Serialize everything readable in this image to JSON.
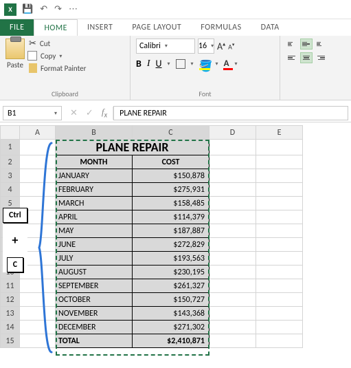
{
  "qat": {
    "save": "💾",
    "undo": "↶",
    "redo": "↷",
    "custom": "⋯"
  },
  "tabs": {
    "file": "FILE",
    "home": "HOME",
    "insert": "INSERT",
    "pagelayout": "PAGE LAYOUT",
    "formulas": "FORMULAS",
    "data": "DATA"
  },
  "ribbon": {
    "clipboard": {
      "paste": "Paste",
      "cut": "Cut",
      "copy": "Copy",
      "fmt": "Format Painter",
      "group": "Clipboard"
    },
    "font": {
      "name": "Calibri",
      "size": "16",
      "group": "Font"
    }
  },
  "namebox": "B1",
  "formula_value": "PLANE REPAIR",
  "cols": [
    "A",
    "B",
    "C",
    "D",
    "E"
  ],
  "table": {
    "title": "PLANE REPAIR",
    "headers": {
      "b": "MONTH",
      "c": "COST"
    },
    "rows": [
      {
        "b": "JANUARY",
        "c": "$150,878"
      },
      {
        "b": "FEBRUARY",
        "c": "$275,931"
      },
      {
        "b": "MARCH",
        "c": "$158,485"
      },
      {
        "b": "APRIL",
        "c": "$114,379"
      },
      {
        "b": "MAY",
        "c": "$187,887"
      },
      {
        "b": "JUNE",
        "c": "$272,829"
      },
      {
        "b": "JULY",
        "c": "$193,563"
      },
      {
        "b": "AUGUST",
        "c": "$230,195"
      },
      {
        "b": "SEPTEMBER",
        "c": "$261,327"
      },
      {
        "b": "OCTOBER",
        "c": "$150,727"
      },
      {
        "b": "NOVEMBER",
        "c": "$143,368"
      },
      {
        "b": "DECEMBER",
        "c": "$271,302"
      }
    ],
    "total": {
      "b": "TOTAL",
      "c": "$2,410,871"
    }
  },
  "keys": {
    "ctrl": "Ctrl",
    "plus": "+",
    "c": "C"
  },
  "chart_data": {
    "type": "table",
    "title": "PLANE REPAIR",
    "columns": [
      "MONTH",
      "COST"
    ],
    "rows": [
      [
        "JANUARY",
        150878
      ],
      [
        "FEBRUARY",
        275931
      ],
      [
        "MARCH",
        158485
      ],
      [
        "APRIL",
        114379
      ],
      [
        "MAY",
        187887
      ],
      [
        "JUNE",
        272829
      ],
      [
        "JULY",
        193563
      ],
      [
        "AUGUST",
        230195
      ],
      [
        "SEPTEMBER",
        261327
      ],
      [
        "OCTOBER",
        150727
      ],
      [
        "NOVEMBER",
        143368
      ],
      [
        "DECEMBER",
        271302
      ]
    ],
    "total": 2410871
  }
}
